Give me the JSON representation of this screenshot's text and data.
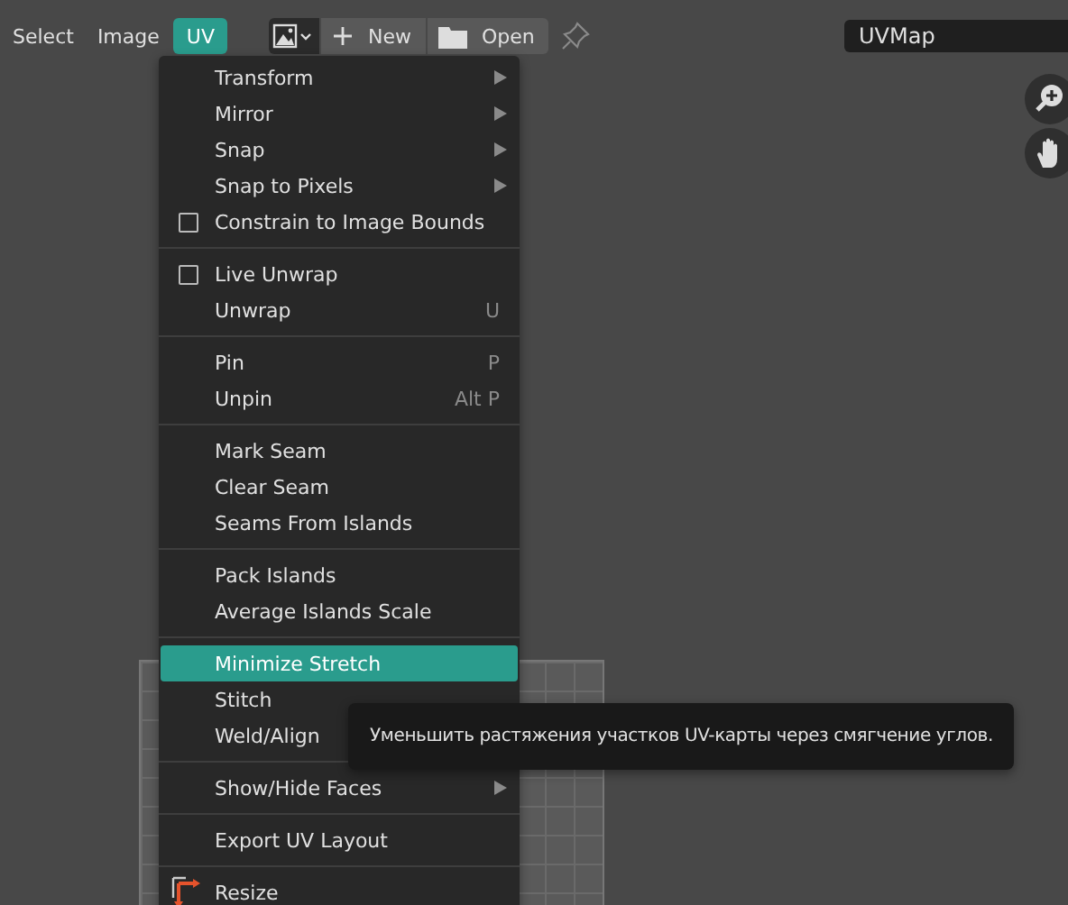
{
  "header": {
    "menus": [
      {
        "label": "Select",
        "selected": false
      },
      {
        "label": "Image",
        "selected": false
      },
      {
        "label": "UV",
        "selected": true
      }
    ],
    "new_button": "New",
    "open_button": "Open",
    "uv_map_field": "UVMap"
  },
  "uv_menu": {
    "items": [
      {
        "kind": "submenu",
        "label": "Transform",
        "selected": false
      },
      {
        "kind": "submenu",
        "label": "Mirror",
        "selected": false
      },
      {
        "kind": "submenu",
        "label": "Snap",
        "selected": false
      },
      {
        "kind": "submenu",
        "label": "Snap to Pixels",
        "selected": false
      },
      {
        "kind": "checkbox",
        "label": "Constrain to Image Bounds",
        "checked": false,
        "selected": false
      },
      {
        "kind": "separator"
      },
      {
        "kind": "checkbox",
        "label": "Live Unwrap",
        "checked": false,
        "selected": false
      },
      {
        "kind": "item",
        "label": "Unwrap",
        "shortcut": "U",
        "selected": false
      },
      {
        "kind": "separator"
      },
      {
        "kind": "item",
        "label": "Pin",
        "shortcut": "P",
        "selected": false
      },
      {
        "kind": "item",
        "label": "Unpin",
        "shortcut": "Alt P",
        "selected": false
      },
      {
        "kind": "separator"
      },
      {
        "kind": "item",
        "label": "Mark Seam",
        "selected": false
      },
      {
        "kind": "item",
        "label": "Clear Seam",
        "selected": false
      },
      {
        "kind": "item",
        "label": "Seams From Islands",
        "selected": false
      },
      {
        "kind": "separator"
      },
      {
        "kind": "item",
        "label": "Pack Islands",
        "selected": false
      },
      {
        "kind": "item",
        "label": "Average Islands Scale",
        "selected": false
      },
      {
        "kind": "separator"
      },
      {
        "kind": "item",
        "label": "Minimize Stretch",
        "selected": true
      },
      {
        "kind": "item",
        "label": "Stitch",
        "selected": false
      },
      {
        "kind": "item",
        "label": "Weld/Align",
        "selected": false
      },
      {
        "kind": "separator"
      },
      {
        "kind": "submenu",
        "label": "Show/Hide Faces",
        "selected": false
      },
      {
        "kind": "separator"
      },
      {
        "kind": "item",
        "label": "Export UV Layout",
        "selected": false
      },
      {
        "kind": "separator"
      },
      {
        "kind": "tool",
        "label": "Resize",
        "selected": false
      }
    ]
  },
  "tooltip": "Уменьшить растяжения участков UV-карты через смягчение углов."
}
